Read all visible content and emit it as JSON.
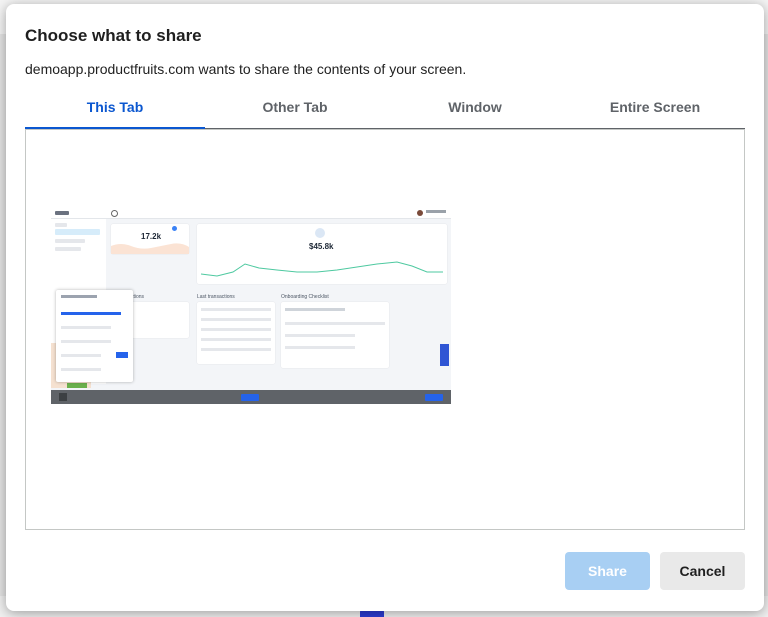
{
  "dialog": {
    "title": "Choose what to share",
    "subtitle": "demoapp.productfruits.com wants to share the contents of your screen.",
    "tabs": [
      {
        "label": "This Tab",
        "active": true
      },
      {
        "label": "Other Tab",
        "active": false
      },
      {
        "label": "Window",
        "active": false
      },
      {
        "label": "Entire Screen",
        "active": false
      }
    ],
    "share_label": "Share",
    "cancel_label": "Cancel"
  },
  "preview": {
    "stat_card_value": "17.2k",
    "revenue_value": "$45.8k",
    "last_transactions_title": "Last transactions",
    "onboarding_title": "Onboarding Checklist",
    "transactions_suffix": "ctions"
  },
  "colors": {
    "accent": "#0b57d0",
    "share_disabled": "#a8cff3",
    "cancel_bg": "#e9e9e9",
    "chart_line": "#4ec9a0"
  }
}
